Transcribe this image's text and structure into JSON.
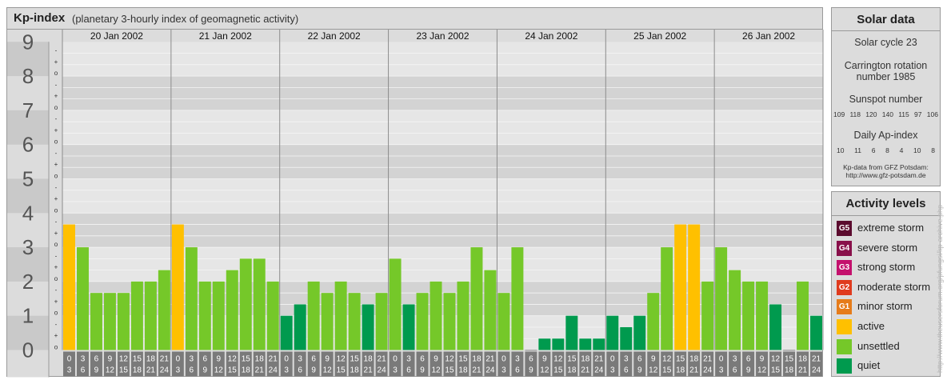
{
  "header": {
    "title": "Kp-index",
    "subtitle": "(planetary 3-hourly index of geomagnetic activity)"
  },
  "chart_data": {
    "type": "bar",
    "ylim": [
      0,
      9
    ],
    "y_ticks": [
      "0",
      "1",
      "2",
      "3",
      "4",
      "5",
      "6",
      "7",
      "8",
      "9"
    ],
    "minor_tick_labels": [
      "o",
      "+",
      "-"
    ],
    "days": [
      "20 Jan 2002",
      "21 Jan 2002",
      "22 Jan 2002",
      "23 Jan 2002",
      "24 Jan 2002",
      "25 Jan 2002",
      "26 Jan 2002"
    ],
    "interval_labels": [
      [
        "0",
        "3"
      ],
      [
        "3",
        "6"
      ],
      [
        "6",
        "9"
      ],
      [
        "9",
        "12"
      ],
      [
        "12",
        "15"
      ],
      [
        "15",
        "18"
      ],
      [
        "18",
        "21"
      ],
      [
        "21",
        "24"
      ]
    ],
    "values": [
      [
        3.667,
        3.0,
        1.667,
        1.667,
        1.667,
        2.0,
        2.0,
        2.333
      ],
      [
        3.667,
        3.0,
        2.0,
        2.0,
        2.333,
        2.667,
        2.667,
        2.0
      ],
      [
        1.0,
        1.333,
        2.0,
        1.667,
        2.0,
        1.667,
        1.333,
        1.667
      ],
      [
        2.667,
        1.333,
        1.667,
        2.0,
        1.667,
        2.0,
        3.0,
        2.333
      ],
      [
        1.667,
        3.0,
        0.0,
        0.333,
        0.333,
        1.0,
        0.333,
        0.333
      ],
      [
        1.0,
        0.667,
        1.0,
        1.667,
        3.0,
        3.667,
        3.667,
        2.0
      ],
      [
        3.0,
        2.333,
        2.0,
        2.0,
        1.333,
        0.0,
        2.0,
        1.0
      ]
    ],
    "level_colors": {
      "quiet": "#009a4e",
      "unsettled": "#75c829",
      "active": "#ffc000"
    }
  },
  "solar": {
    "title": "Solar data",
    "cycle": "Solar cycle 23",
    "carrington_line1": "Carrington rotation",
    "carrington_line2": "number 1985",
    "sunspot_title": "Sunspot number",
    "sunspot_values": [
      "109",
      "118",
      "120",
      "140",
      "115",
      "97",
      "106"
    ],
    "ap_title": "Daily Ap-index",
    "ap_values": [
      "10",
      "11",
      "6",
      "8",
      "4",
      "10",
      "8"
    ],
    "source_line1": "Kp-data from GFZ Potsdam:",
    "source_line2": "http://www.gfz-potsdam.de"
  },
  "activity": {
    "title": "Activity levels",
    "levels": [
      {
        "badge": "G5",
        "label": "extreme storm",
        "color": "#5b0b2e"
      },
      {
        "badge": "G4",
        "label": "severe storm",
        "color": "#88104a"
      },
      {
        "badge": "G3",
        "label": "strong storm",
        "color": "#c4116d"
      },
      {
        "badge": "G2",
        "label": "moderate storm",
        "color": "#e03b1e"
      },
      {
        "badge": "G1",
        "label": "minor storm",
        "color": "#e67c1a"
      },
      {
        "badge": "",
        "label": "active",
        "color": "#ffc000"
      },
      {
        "badge": "",
        "label": "unsettled",
        "color": "#75c829"
      },
      {
        "badge": "",
        "label": "quiet",
        "color": "#009a4e"
      }
    ]
  },
  "credit": "http://www.theusersforum.org/pfungsi/kp-archive.php"
}
